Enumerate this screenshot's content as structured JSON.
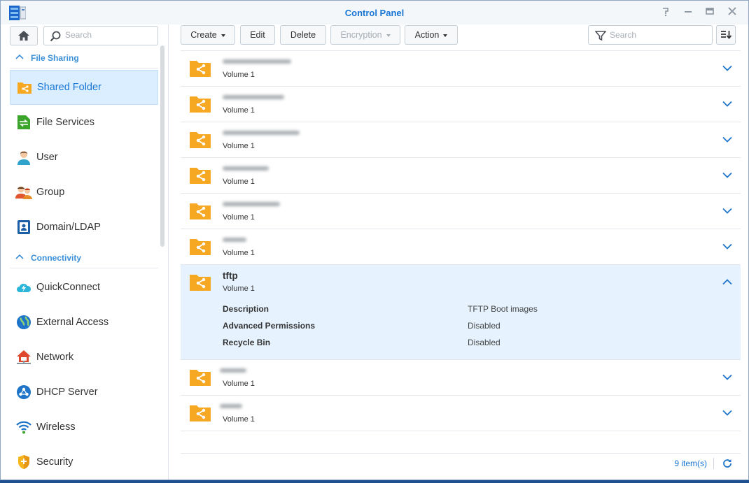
{
  "window": {
    "title": "Control Panel",
    "buttons": [
      "help-icon",
      "minimize-icon",
      "maximize-icon",
      "close-icon"
    ]
  },
  "sidebar": {
    "search_placeholder": "Search",
    "sections": [
      {
        "label": "File Sharing",
        "items": [
          {
            "label": "Shared Folder",
            "icon": "shared-folder-icon",
            "active": true
          },
          {
            "label": "File Services",
            "icon": "file-services-icon"
          },
          {
            "label": "User",
            "icon": "user-icon"
          },
          {
            "label": "Group",
            "icon": "group-icon"
          },
          {
            "label": "Domain/LDAP",
            "icon": "domain-ldap-icon"
          }
        ]
      },
      {
        "label": "Connectivity",
        "items": [
          {
            "label": "QuickConnect",
            "icon": "quickconnect-icon"
          },
          {
            "label": "External Access",
            "icon": "external-access-icon"
          },
          {
            "label": "Network",
            "icon": "network-icon"
          },
          {
            "label": "DHCP Server",
            "icon": "dhcp-server-icon"
          },
          {
            "label": "Wireless",
            "icon": "wireless-icon"
          },
          {
            "label": "Security",
            "icon": "security-icon"
          }
        ]
      }
    ]
  },
  "toolbar": {
    "create": "Create",
    "edit": "Edit",
    "delete": "Delete",
    "encryption": "Encryption",
    "action": "Action",
    "search_placeholder": "Search"
  },
  "folders": [
    {
      "name": "",
      "volume": "Volume 1",
      "redacted": true
    },
    {
      "name": "",
      "volume": "Volume 1",
      "redacted": true
    },
    {
      "name": "",
      "volume": "Volume 1",
      "redacted": true
    },
    {
      "name": "",
      "volume": "Volume 1",
      "redacted": true
    },
    {
      "name": "",
      "volume": "Volume 1",
      "redacted": true
    },
    {
      "name": "",
      "volume": "Volume 1",
      "redacted": true
    },
    {
      "name": "tftp",
      "volume": "Volume 1",
      "expanded": true,
      "details": [
        {
          "key": "Description",
          "value": "TFTP Boot images"
        },
        {
          "key": "Advanced Permissions",
          "value": "Disabled"
        },
        {
          "key": "Recycle Bin",
          "value": "Disabled"
        }
      ]
    },
    {
      "name": "",
      "volume": "Volume 1",
      "redacted": true
    },
    {
      "name": "",
      "volume": "Volume 1",
      "redacted": true
    }
  ],
  "footer": {
    "count": "9 item(s)"
  },
  "colors": {
    "accent": "#1775d4",
    "folder": "#f7a823",
    "selected_bg": "#dbeeff"
  }
}
